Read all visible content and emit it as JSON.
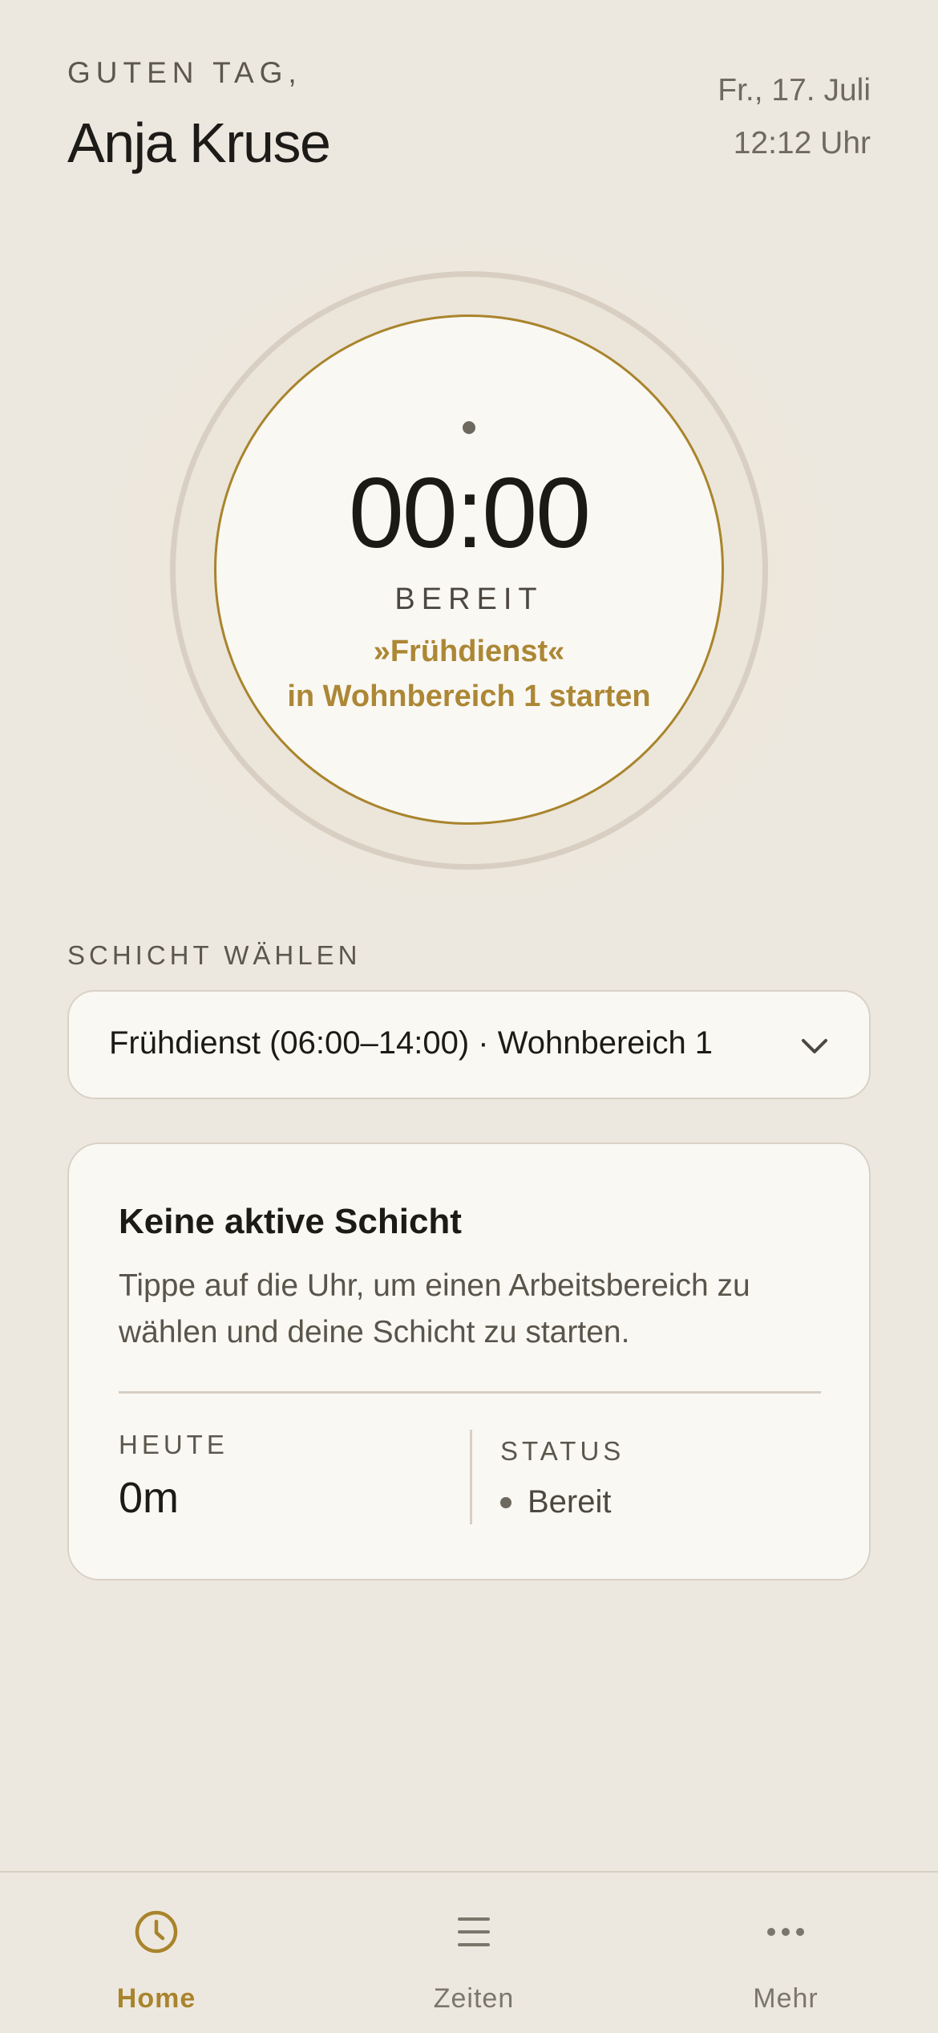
{
  "header": {
    "greeting": "GUTEN TAG,",
    "user_name": "Anja Kruse",
    "date": "Fr., 17. Juli",
    "time": "12:12 Uhr"
  },
  "clock": {
    "elapsed": "00:00",
    "status": "BEREIT",
    "hint_line1": "»Frühdienst«",
    "hint_line2": "in Wohnbereich 1 starten"
  },
  "shift_select": {
    "label": "SCHICHT WÄHLEN",
    "selected_value": "Frühdienst (06:00–14:00) · Wohnbereich 1"
  },
  "info_card": {
    "title": "Keine aktive Schicht",
    "text_line1": "Tippe auf die Uhr, um einen Arbeitsbereich zu",
    "text_line2": "wählen und deine Schicht zu starten.",
    "today_label": "HEUTE",
    "today_value": "0m",
    "status_label": "STATUS",
    "status_value": "Bereit"
  },
  "bottom_nav": {
    "items": [
      {
        "label": "Home",
        "icon": "clock-icon",
        "active": true
      },
      {
        "label": "Zeiten",
        "icon": "list-icon",
        "active": false
      },
      {
        "label": "Mehr",
        "icon": "more-icon",
        "active": false
      }
    ]
  },
  "colors": {
    "background": "#ede8df",
    "card": "#faf8f3",
    "accent": "#a9842c",
    "text": "#1c1b18",
    "muted": "#6f6a60"
  }
}
